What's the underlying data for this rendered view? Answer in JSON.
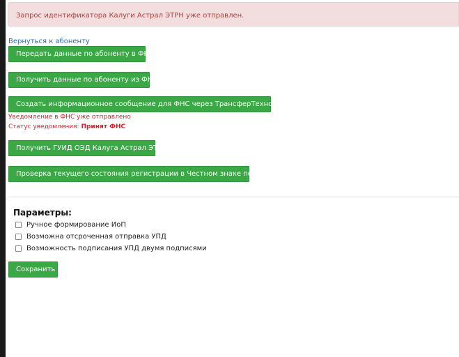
{
  "alert": {
    "text": "Запрос идентификатора Калуги Астрал ЭТРН уже отправлен."
  },
  "back_link": "Вернуться к абоненту",
  "actions": {
    "send_fns": "Передать данные по абоненту в ФНС",
    "get_fns": "Получить данные по абоненту из ФНС",
    "create_message": "Создать информационное сообщение для ФНС через ТрансферТехнологии",
    "get_guid": "Получить ГУИД ОЭД Калуга Астрал ЭТРН",
    "check_status": "Проверка текущего состояния регистрации в Честном знаке по ИНН"
  },
  "notices": {
    "sent": "Уведомление в ФНС уже отправлено",
    "status_label": "Статус уведомления:",
    "status_value": "Принят ФНС"
  },
  "params": {
    "title": "Параметры:",
    "items": [
      {
        "label": "Ручное формирование ИоП",
        "checked": false
      },
      {
        "label": "Возможна отсроченная отправка УПД",
        "checked": false
      },
      {
        "label": "Возможность подписания УПД двумя подписями",
        "checked": false
      }
    ]
  },
  "save_label": "Сохранить",
  "colors": {
    "button_green": "#3aa845",
    "alert_bg": "#f2dede",
    "alert_text": "#a94442",
    "notice_red": "#e3202a",
    "link_blue": "#2a6ebb"
  }
}
